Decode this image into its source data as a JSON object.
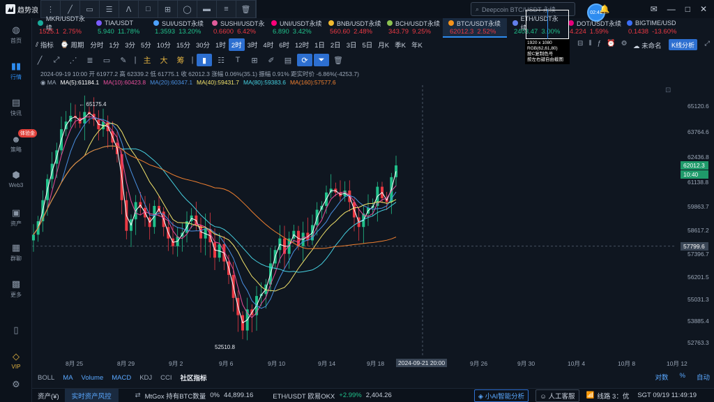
{
  "app": {
    "name": "趋势浪"
  },
  "search": {
    "placeholder": "Deepcoin BTC/USDT 永续"
  },
  "avatar": "02:41",
  "nav": [
    {
      "label": "首页",
      "icon": "home-icon"
    },
    {
      "label": "行情",
      "icon": "chart-bars-icon",
      "active": true
    },
    {
      "label": "快讯",
      "icon": "news-icon"
    },
    {
      "label": "策略",
      "icon": "robot-icon",
      "badge": "体验金"
    },
    {
      "label": "Web3",
      "icon": "web3-icon"
    },
    {
      "label": "资产",
      "icon": "wallet-icon"
    },
    {
      "label": "群聊",
      "icon": "chat-icon"
    },
    {
      "label": "更多",
      "icon": "grid-icon"
    },
    {
      "label": "",
      "icon": "phone-icon"
    },
    {
      "label": "VIP",
      "icon": "diamond-icon"
    },
    {
      "label": "",
      "icon": "settings-icon"
    }
  ],
  "tickers": [
    {
      "name": "MKR/USDT永续",
      "price": "1525.1",
      "change": "2.75%",
      "dir": "dn",
      "color": "#1aab9b"
    },
    {
      "name": "TIA/USDT",
      "price": "5.940",
      "change": "11.78%",
      "dir": "up",
      "color": "#7b5cff"
    },
    {
      "name": "SUI/USDT永续",
      "price": "1.3593",
      "change": "13.20%",
      "dir": "up",
      "color": "#4da2ff"
    },
    {
      "name": "SUSHI/USDT永",
      "price": "0.6600",
      "change": "6.42%",
      "dir": "dn",
      "color": "#e05c9a"
    },
    {
      "name": "UNI/USDT永续",
      "price": "6.890",
      "change": "3.42%",
      "dir": "up",
      "color": "#ff007a"
    },
    {
      "name": "BNB/USDT永续",
      "price": "560.60",
      "change": "2.48%",
      "dir": "dn",
      "color": "#f3ba2f"
    },
    {
      "name": "BCH/USDT永续",
      "price": "343.79",
      "change": "9.25%",
      "dir": "dn",
      "color": "#8dc351"
    },
    {
      "name": "BTC/USDT永续",
      "price": "62012.3",
      "change": "2.52%",
      "dir": "dn",
      "color": "#f7931a",
      "selected": true
    },
    {
      "name": "ETH/USDT永续",
      "price": "2403.47",
      "change": "3.00%",
      "dir": "up",
      "color": "#627eea"
    },
    {
      "name": "DOT/USDT永续",
      "price": "4.224",
      "change": "1.59%",
      "dir": "dn",
      "color": "#e6007a"
    },
    {
      "name": "BIGTIME/USD",
      "price": "0.1438",
      "change": "-13.60%",
      "dir": "dn",
      "color": "#3b6ef5"
    }
  ],
  "toolbar": {
    "indicator": "指标",
    "period": "周期",
    "intervals": [
      "分时",
      "1分",
      "3分",
      "5分",
      "10分",
      "15分",
      "30分",
      "1时",
      "2时",
      "3时",
      "4时",
      "6时",
      "12时",
      "1日",
      "2日",
      "3日",
      "5日",
      "月K",
      "季K",
      "年K"
    ],
    "selected_interval": "2时",
    "unnamed": "未命名",
    "kline_analysis": "K线分析"
  },
  "drawtools": {
    "main": "主",
    "big": "大",
    "chip": "筹"
  },
  "candle_info": "2024-09-19 10:00  开 61977.2  高 62339.2  低 61775.1  收 62012.3  涨幅 0.06%(35.1)  振幅 0.91%  距实时价 -6.86%(-4253.7)",
  "ma": [
    {
      "label": "MA(5):61184.1",
      "color": "#ffffff"
    },
    {
      "label": "MA(10):60423.8",
      "color": "#e84f9c"
    },
    {
      "label": "MA(20):60347.1",
      "color": "#4a90e2"
    },
    {
      "label": "MA(40):59431.7",
      "color": "#f2e36b"
    },
    {
      "label": "MA(80):59383.6",
      "color": "#46d0e0"
    },
    {
      "label": "MA(160):57577.6",
      "color": "#f08030"
    }
  ],
  "chart_data": {
    "type": "candlestick",
    "y_ticks": [
      65120.6,
      63764.6,
      62436.8,
      61138.8,
      59863.7,
      58617.2,
      57396.7,
      56201.5,
      55031.3,
      53885.4,
      52763.3
    ],
    "ylim": [
      52000,
      66200
    ],
    "x_ticks": [
      "8月 25",
      "8月 29",
      "9月 2",
      "9月 6",
      "9月 10",
      "9月 14",
      "9月 18",
      "9月 26",
      "9月 30",
      "10月 4",
      "10月 8",
      "10月 12"
    ],
    "crosshair_x": "2024-09-21 20:00",
    "crosshair_price": "57799.6",
    "current_price": "62012.3",
    "countdown": "10:40",
    "max_label": "65175.4",
    "min_label": "52510.8",
    "close_series": [
      58400,
      59100,
      60200,
      61300,
      62100,
      62800,
      63900,
      64300,
      64600,
      64500,
      64200,
      64800,
      64700,
      64400,
      63900,
      64300,
      63800,
      63200,
      62600,
      60200,
      58600,
      59200,
      60100,
      59800,
      59300,
      58800,
      59900,
      59600,
      58800,
      58200,
      57800,
      58300,
      58500,
      59100,
      59400,
      58900,
      58200,
      58700,
      58000,
      57200,
      57900,
      57000,
      56300,
      55100,
      54200,
      53400,
      54500,
      54200,
      55200,
      55300,
      55800,
      56900,
      57600,
      58200,
      57400,
      58200,
      58600,
      57800,
      58500,
      58100,
      58900,
      59700,
      59900,
      60600,
      60800,
      60600,
      60400,
      60700,
      60100,
      59300,
      58800,
      59500,
      59800,
      59900,
      60900,
      60300,
      60100,
      61400,
      62012
    ]
  },
  "indicators": {
    "items": [
      "BOLL",
      "MA",
      "Volume",
      "MACD",
      "KDJ",
      "CCI"
    ],
    "community": "社区指标",
    "right": [
      "对数",
      "%",
      "自动"
    ]
  },
  "status": {
    "asset": "资产(¥)",
    "risk": "实时资产风控",
    "news1": "MtGox 持有BTC数量",
    "news1_val": "0%",
    "news1_amt": "44,899.16",
    "news2": "ETH/USDT 欧易OKX",
    "news2_chg": "+2.99%",
    "news2_price": "2,404.26",
    "ai": "小AI智能分析",
    "service": "人工客服",
    "line": "线路 3：优",
    "time": "SGT 09/19 11:49:19"
  },
  "tooltip": [
    "1920 x 1080",
    "RGB(62,61,80)",
    "按C复制色号",
    "按左右键自由截图"
  ]
}
